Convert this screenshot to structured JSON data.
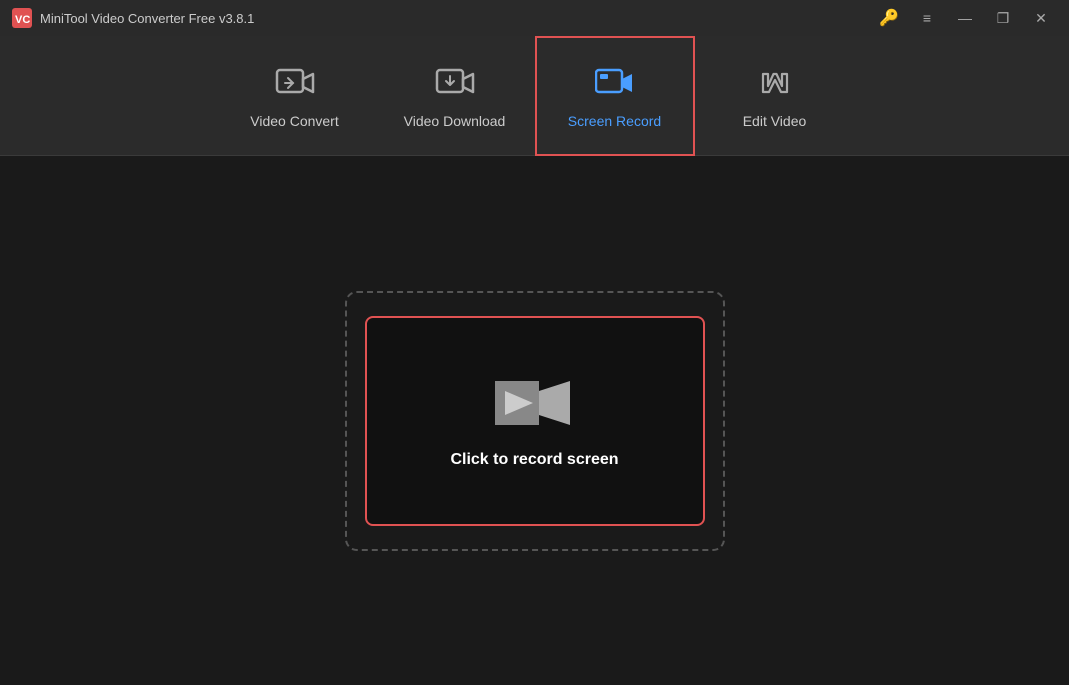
{
  "titleBar": {
    "appName": "MiniTool Video Converter Free v3.8.1",
    "controls": {
      "menuLabel": "≡",
      "minimizeLabel": "—",
      "maximizeLabel": "❐",
      "closeLabel": "✕"
    }
  },
  "nav": {
    "items": [
      {
        "id": "video-convert",
        "label": "Video Convert",
        "active": false
      },
      {
        "id": "video-download",
        "label": "Video Download",
        "active": false
      },
      {
        "id": "screen-record",
        "label": "Screen Record",
        "active": true
      },
      {
        "id": "edit-video",
        "label": "Edit Video",
        "active": false
      }
    ]
  },
  "main": {
    "recordButton": {
      "label": "Click to record screen"
    }
  }
}
